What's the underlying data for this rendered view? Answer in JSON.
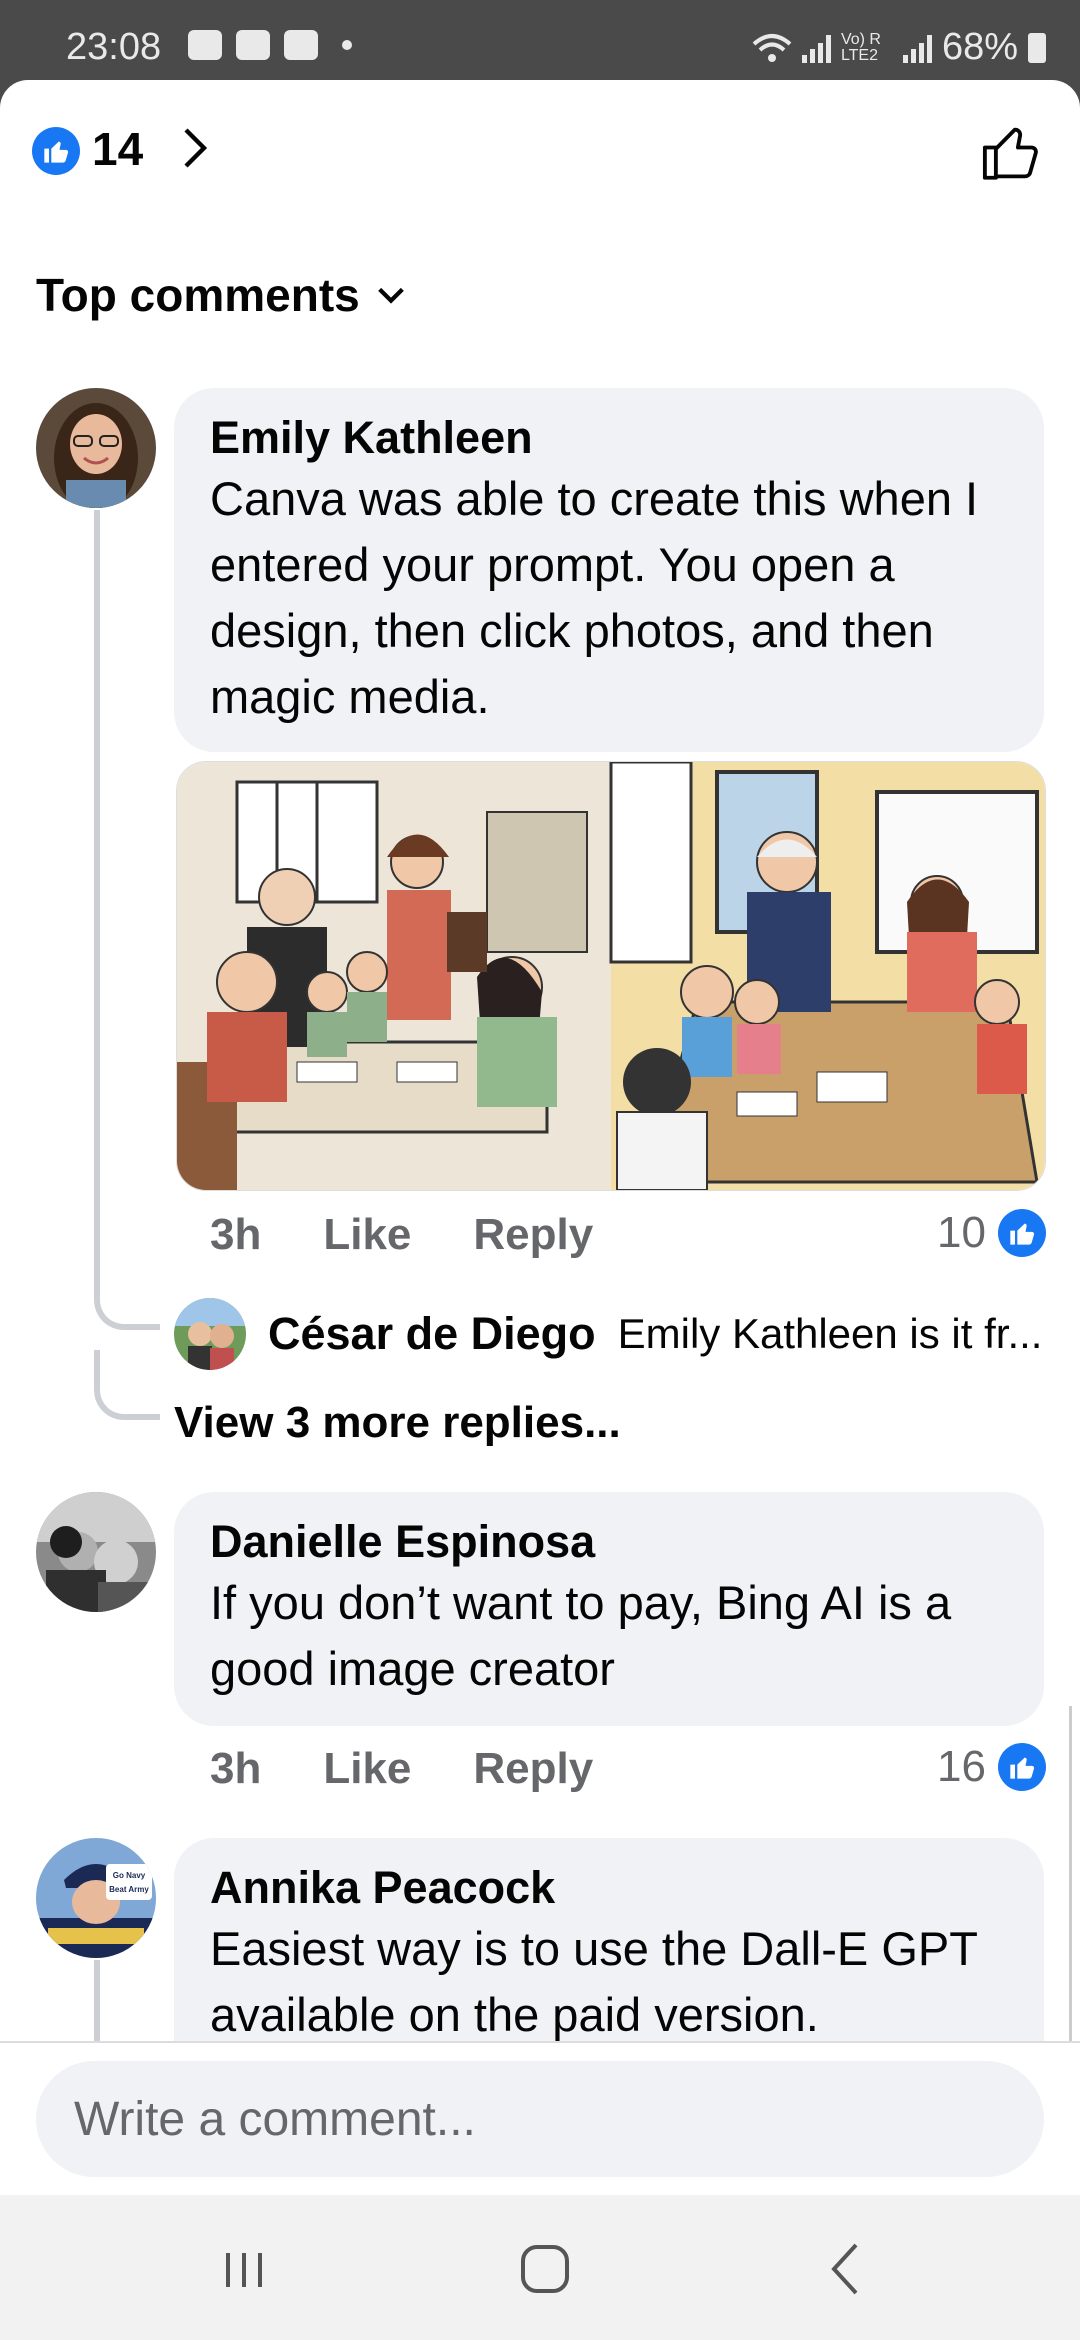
{
  "status_bar": {
    "time": "23:08",
    "battery": "68%",
    "network": "Vo) R LTE2"
  },
  "header": {
    "reaction_count": "14"
  },
  "sort": {
    "label": "Top comments"
  },
  "comments": [
    {
      "author": "Emily Kathleen",
      "text": "Canva was able to create this when I entered your prompt. You open a design, then click photos, and then magic media.",
      "time": "3h",
      "like_label": "Like",
      "reply_label": "Reply",
      "reactions": "10"
    },
    {
      "author": "Danielle Espinosa",
      "text": "If you don’t want to pay, Bing AI is a good image creator",
      "time": "3h",
      "like_label": "Like",
      "reply_label": "Reply",
      "reactions": "16"
    },
    {
      "author": "Annika Peacock",
      "text": "Easiest way is to use the Dall-E GPT available on the paid version."
    }
  ],
  "reply_preview": {
    "author": "César de Diego",
    "text": "Emily Kathleen is it fr..."
  },
  "view_more_replies": "View 3 more replies...",
  "avatar_badge": {
    "line1": "Go Navy",
    "line2": "Beat Army"
  },
  "composer": {
    "placeholder": "Write a comment..."
  },
  "colors": {
    "accent": "#1877f2",
    "bubble": "#f0f2f5",
    "muted": "#65676b"
  }
}
